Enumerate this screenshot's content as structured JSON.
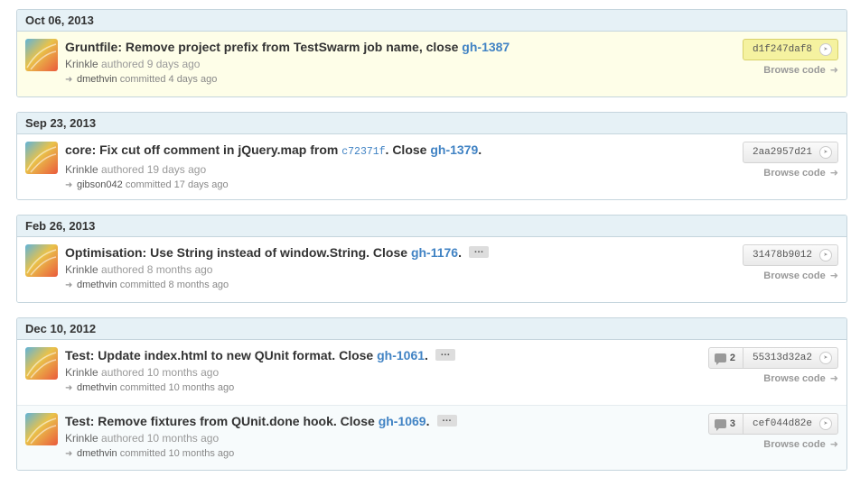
{
  "groups": [
    {
      "date": "Oct 06, 2013",
      "commits": [
        {
          "message_parts": [
            {
              "text": "Gruntfile: Remove project prefix from TestSwarm job name, close ",
              "kind": "text"
            },
            {
              "text": "gh-1387",
              "kind": "link"
            }
          ],
          "has_expander": false,
          "author": "Krinkle",
          "authored_label": "authored",
          "authored_when": "9 days ago",
          "committer": "dmethvin",
          "committed_label": "committed",
          "committed_when": "4 days ago",
          "sha": "d1f247daf8",
          "comments": null,
          "browse_label": "Browse code",
          "highlight": true
        }
      ]
    },
    {
      "date": "Sep 23, 2013",
      "commits": [
        {
          "message_parts": [
            {
              "text": "core: Fix cut off comment in jQuery.map from ",
              "kind": "text"
            },
            {
              "text": "c72371f",
              "kind": "sha"
            },
            {
              "text": ". Close ",
              "kind": "text"
            },
            {
              "text": "gh-1379",
              "kind": "link"
            },
            {
              "text": ".",
              "kind": "text"
            }
          ],
          "has_expander": false,
          "author": "Krinkle",
          "authored_label": "authored",
          "authored_when": "19 days ago",
          "committer": "gibson042",
          "committed_label": "committed",
          "committed_when": "17 days ago",
          "sha": "2aa2957d21",
          "comments": null,
          "browse_label": "Browse code",
          "highlight": false
        }
      ]
    },
    {
      "date": "Feb 26, 2013",
      "commits": [
        {
          "message_parts": [
            {
              "text": "Optimisation: Use String instead of window.String. Close ",
              "kind": "text"
            },
            {
              "text": "gh-1176",
              "kind": "link"
            },
            {
              "text": ".",
              "kind": "text"
            }
          ],
          "has_expander": true,
          "author": "Krinkle",
          "authored_label": "authored",
          "authored_when": "8 months ago",
          "committer": "dmethvin",
          "committed_label": "committed",
          "committed_when": "8 months ago",
          "sha": "31478b9012",
          "comments": null,
          "browse_label": "Browse code",
          "highlight": false
        }
      ]
    },
    {
      "date": "Dec 10, 2012",
      "commits": [
        {
          "message_parts": [
            {
              "text": "Test: Update index.html to new QUnit format. Close ",
              "kind": "text"
            },
            {
              "text": "gh-1061",
              "kind": "link"
            },
            {
              "text": ".",
              "kind": "text"
            }
          ],
          "has_expander": true,
          "author": "Krinkle",
          "authored_label": "authored",
          "authored_when": "10 months ago",
          "committer": "dmethvin",
          "committed_label": "committed",
          "committed_when": "10 months ago",
          "sha": "55313d32a2",
          "comments": "2",
          "browse_label": "Browse code",
          "highlight": false
        },
        {
          "message_parts": [
            {
              "text": "Test: Remove fixtures from QUnit.done hook. Close ",
              "kind": "text"
            },
            {
              "text": "gh-1069",
              "kind": "link"
            },
            {
              "text": ".",
              "kind": "text"
            }
          ],
          "has_expander": true,
          "author": "Krinkle",
          "authored_label": "authored",
          "authored_when": "10 months ago",
          "committer": "dmethvin",
          "committed_label": "committed",
          "committed_when": "10 months ago",
          "sha": "cef044d82e",
          "comments": "3",
          "browse_label": "Browse code",
          "highlight": false
        }
      ]
    }
  ],
  "expander_label": "…",
  "colors": {
    "header_bg": "#e6f1f6",
    "border": "#c5d5dd",
    "link": "#4183c4",
    "highlight_bg": "#fefee8",
    "sha_highlight_bg": "#f5f2a0"
  },
  "icons": {
    "avatar": "avatar-identicon",
    "committer_arrow": "arrow-right-icon",
    "sha_go": "chevron-circle-right-icon",
    "comments": "comment-bubble-icon",
    "browse": "chevron-right-icon"
  }
}
